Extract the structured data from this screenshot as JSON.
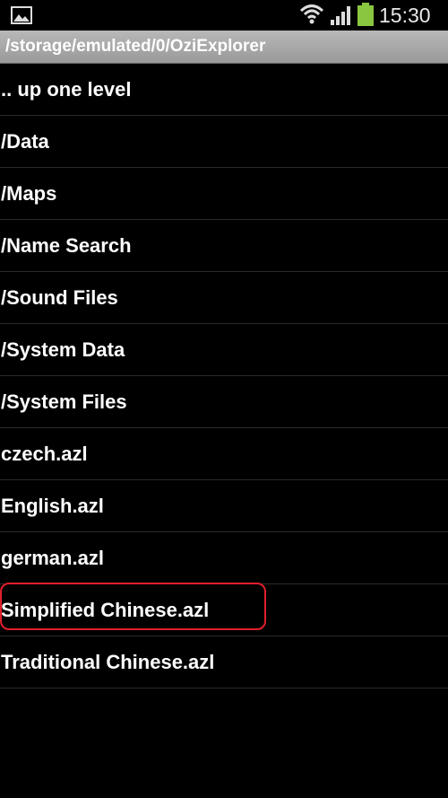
{
  "status_bar": {
    "time": "15:30",
    "icons": [
      "gallery-icon",
      "wifi-icon",
      "signal-icon",
      "battery-icon"
    ],
    "battery_color": "#8ac640"
  },
  "path_bar": {
    "path": "/storage/emulated/0/OziExplorer"
  },
  "file_list": {
    "items": [
      {
        "label": ".. up one level"
      },
      {
        "label": "/Data"
      },
      {
        "label": "/Maps"
      },
      {
        "label": "/Name Search"
      },
      {
        "label": "/Sound Files"
      },
      {
        "label": "/System Data"
      },
      {
        "label": "/System Files"
      },
      {
        "label": "czech.azl"
      },
      {
        "label": "English.azl"
      },
      {
        "label": "german.azl"
      },
      {
        "label": "Simplified Chinese.azl"
      },
      {
        "label": "Traditional Chinese.azl"
      }
    ],
    "highlighted_item": "Simplified Chinese.azl",
    "highlight_color": "#e0202a"
  }
}
